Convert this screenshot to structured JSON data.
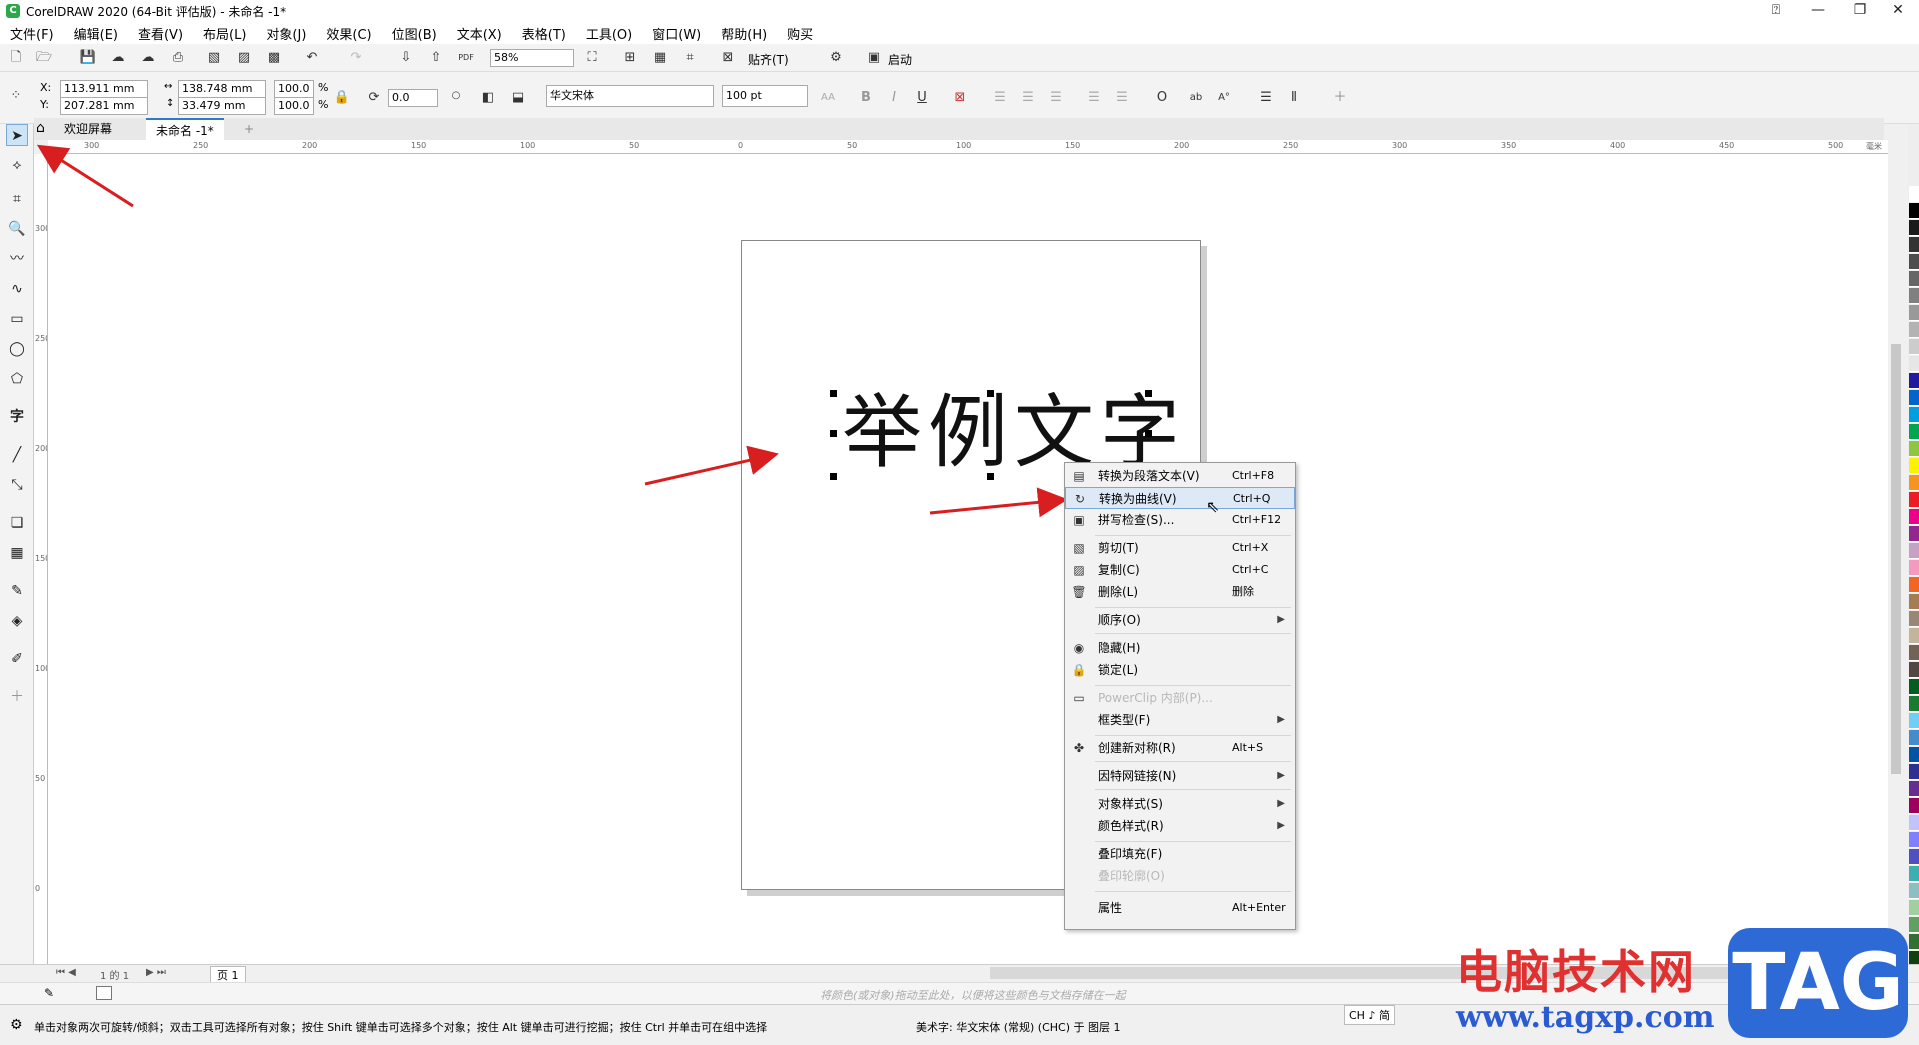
{
  "window": {
    "title": "CorelDRAW 2020 (64-Bit 评估版) - 未命名 -1*"
  },
  "menu": [
    "文件(F)",
    "编辑(E)",
    "查看(V)",
    "布局(L)",
    "对象(J)",
    "效果(C)",
    "位图(B)",
    "文本(X)",
    "表格(T)",
    "工具(O)",
    "窗口(W)",
    "帮助(H)",
    "购买"
  ],
  "toolbar": {
    "zoom": "58%",
    "snap_label": "贴齐(T)",
    "launch_label": "启动"
  },
  "props": {
    "x_label": "X:",
    "x_value": "113.911 mm",
    "y_label": "Y:",
    "y_value": "207.281 mm",
    "w_value": "138.748 mm",
    "h_value": "33.479 mm",
    "scale_x": "100.0",
    "scale_y": "100.0",
    "pct": "%",
    "rotation": "0.0",
    "font_name": "华文宋体",
    "font_size": "100 pt"
  },
  "tabs": {
    "welcome": "欢迎屏幕",
    "doc": "未命名 -1*"
  },
  "ruler_h": [
    "300",
    "250",
    "200",
    "150",
    "100",
    "50",
    "0",
    "50",
    "100",
    "150",
    "200",
    "250",
    "300",
    "350",
    "400",
    "450",
    "500",
    "毫米"
  ],
  "ruler_v": [
    "300",
    "250",
    "200",
    "150",
    "100",
    "50",
    "0"
  ],
  "canvas": {
    "sample_text": "举例文字"
  },
  "context_menu": [
    {
      "icon": "paragraph-text-icon",
      "glyph": "▤",
      "label": "转换为段落文本(V)",
      "shortcut": "Ctrl+F8"
    },
    {
      "icon": "convert-curves-icon",
      "glyph": "↻",
      "label": "转换为曲线(V)",
      "shortcut": "Ctrl+Q"
    },
    {
      "icon": "spellcheck-icon",
      "glyph": "▣",
      "label": "拼写检查(S)...",
      "shortcut": "Ctrl+F12"
    },
    {
      "icon": "cut-icon",
      "glyph": "▧",
      "label": "剪切(T)",
      "shortcut": "Ctrl+X"
    },
    {
      "icon": "copy-icon",
      "glyph": "▨",
      "label": "复制(C)",
      "shortcut": "Ctrl+C"
    },
    {
      "icon": "delete-icon",
      "glyph": "🗑",
      "label": "删除(L)",
      "shortcut": "删除"
    },
    {
      "icon": "",
      "glyph": "",
      "label": "顺序(O)",
      "shortcut": "",
      "submenu": true
    },
    {
      "icon": "eye-icon",
      "glyph": "◉",
      "label": "隐藏(H)",
      "shortcut": ""
    },
    {
      "icon": "lock-icon",
      "glyph": "🔒",
      "label": "锁定(L)",
      "shortcut": ""
    },
    {
      "icon": "powerclip-icon",
      "glyph": "▭",
      "label": "PowerClip 内部(P)...",
      "shortcut": "",
      "disabled": true
    },
    {
      "icon": "",
      "glyph": "",
      "label": "框类型(F)",
      "shortcut": "",
      "submenu": true
    },
    {
      "icon": "symmetry-icon",
      "glyph": "✤",
      "label": "创建新对称(R)",
      "shortcut": "Alt+S"
    },
    {
      "icon": "",
      "glyph": "",
      "label": "因特网链接(N)",
      "shortcut": "",
      "submenu": true
    },
    {
      "icon": "",
      "glyph": "",
      "label": "对象样式(S)",
      "shortcut": "",
      "submenu": true
    },
    {
      "icon": "",
      "glyph": "",
      "label": "颜色样式(R)",
      "shortcut": "",
      "submenu": true
    },
    {
      "icon": "",
      "glyph": "",
      "label": "叠印填充(F)",
      "shortcut": ""
    },
    {
      "icon": "",
      "glyph": "",
      "label": "叠印轮廓(O)",
      "shortcut": "",
      "disabled": true
    },
    {
      "icon": "",
      "glyph": "",
      "label": "属性",
      "shortcut": "Alt+Enter"
    }
  ],
  "page_nav": {
    "page_count": "1 的 1",
    "page_tab": "页 1"
  },
  "color_hint": "将颜色(或对象)拖动至此处，以便将这些颜色与文档存储在一起",
  "status": {
    "hint": "单击对象两次可旋转/倾斜；双击工具可选择所有对象；按住 Shift 键单击可选择多个对象；按住 Alt 键单击可进行挖掘；按住 Ctrl 并单击可在组中选择",
    "object_info": "美术字: 华文宋体 (常规) (CHC) 于 图层 1",
    "ime": "CH ♪ 简"
  },
  "watermark": {
    "cn": "电脑技术网",
    "url": "www.tagxp.com",
    "tag": "TAG"
  },
  "palette": [
    "#ffffff",
    "#000000",
    "#1a1a1a",
    "#333333",
    "#4d4d4d",
    "#666666",
    "#808080",
    "#999999",
    "#b3b3b3",
    "#cccccc",
    "#e6e6e6",
    "#1f1aa0",
    "#0066cc",
    "#00a0e0",
    "#00a651",
    "#8dc63f",
    "#fff200",
    "#f7941d",
    "#ed1c24",
    "#ec008c",
    "#92278f",
    "#c7a0c8",
    "#f49ac1",
    "#f26522",
    "#a67c52",
    "#998675",
    "#c2b59b",
    "#736357",
    "#534741",
    "#005e20",
    "#197b30",
    "#6dcff6",
    "#448ccb",
    "#0054a6",
    "#2e3192",
    "#662d91",
    "#9e005d",
    "#c2c2ff",
    "#8080ff",
    "#5050c0",
    "#3cb0b0",
    "#8cc0c0",
    "#a0d0a0",
    "#60a060",
    "#307030",
    "#104010",
    "#88aa88",
    "#aaccee",
    "#6699cc",
    "#335577"
  ]
}
